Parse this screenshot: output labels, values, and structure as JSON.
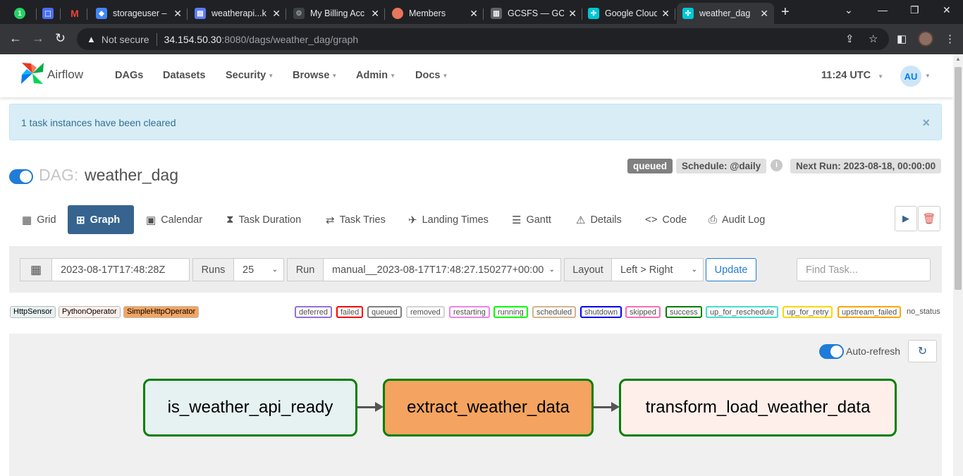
{
  "browser": {
    "tabs": [
      {
        "title": "",
        "favicon": "whatsapp-icon",
        "color": "#25d366"
      },
      {
        "title": "",
        "favicon": "chip-icon",
        "color": "#4c6ef5"
      },
      {
        "title": "",
        "favicon": "gmail-icon",
        "color": "#ea4335"
      },
      {
        "title": "storageuser –",
        "favicon": "shield-icon",
        "color": "#4285f4"
      },
      {
        "title": "weatherapi...k",
        "favicon": "dashboard-icon",
        "color": "#5c7cfa"
      },
      {
        "title": "My Billing Acc",
        "favicon": "gear-icon",
        "color": "#9aa0a6"
      },
      {
        "title": "Members",
        "favicon": "brain-icon",
        "color": "#e8765a"
      },
      {
        "title": "GCSFS — GCS",
        "favicon": "doc-icon",
        "color": "#9aa0a6"
      },
      {
        "title": "Google Cloud",
        "favicon": "airflow-icon",
        "color": "#00c7d4"
      },
      {
        "title": "weather_dag",
        "favicon": "airflow-icon",
        "color": "#00c7d4"
      }
    ],
    "url_warning": "Not secure",
    "url_host": "34.154.50.30",
    "url_path": ":8080/dags/weather_dag/graph"
  },
  "navbar": {
    "brand": "Airflow",
    "menu": [
      "DAGs",
      "Datasets",
      "Security",
      "Browse",
      "Admin",
      "Docs"
    ],
    "time": "11:24 UTC",
    "avatar_initials": "AU"
  },
  "alert": {
    "message": "1 task instances have been cleared",
    "close": "×"
  },
  "dag": {
    "label": "DAG:",
    "id": "weather_dag",
    "state_badge": "queued",
    "schedule": "Schedule: @daily",
    "info": "i",
    "next_run": "Next Run: 2023-08-18, 00:00:00"
  },
  "view_tabs": [
    {
      "label": "Grid",
      "icon": "grid-icon"
    },
    {
      "label": "Graph",
      "icon": "graph-icon"
    },
    {
      "label": "Calendar",
      "icon": "calendar-icon"
    },
    {
      "label": "Task Duration",
      "icon": "hourglass-icon"
    },
    {
      "label": "Task Tries",
      "icon": "retry-icon"
    },
    {
      "label": "Landing Times",
      "icon": "plane-icon"
    },
    {
      "label": "Gantt",
      "icon": "gantt-icon"
    },
    {
      "label": "Details",
      "icon": "warning-icon"
    },
    {
      "label": "Code",
      "icon": "code-icon"
    },
    {
      "label": "Audit Log",
      "icon": "search-file-icon"
    }
  ],
  "filters": {
    "base_date": "2023-08-17T17:48:28Z",
    "runs_label": "Runs",
    "runs_value": "25",
    "run_label": "Run",
    "run_value": "manual__2023-08-17T17:48:27.150277+00:00",
    "layout_label": "Layout",
    "layout_value": "Left > Right",
    "update_label": "Update",
    "find_placeholder": "Find Task..."
  },
  "operators": [
    {
      "name": "HttpSensor",
      "bg": "#e6f1f2"
    },
    {
      "name": "PythonOperator",
      "bg": "#ffefeb"
    },
    {
      "name": "SimpleHttpOperator",
      "bg": "#f4a460"
    }
  ],
  "states": [
    {
      "name": "deferred",
      "color": "#9370db"
    },
    {
      "name": "failed",
      "color": "#ff0000"
    },
    {
      "name": "queued",
      "color": "#808080"
    },
    {
      "name": "removed",
      "color": "#d3d3d3"
    },
    {
      "name": "restarting",
      "color": "#ee82ee"
    },
    {
      "name": "running",
      "color": "#00ff00"
    },
    {
      "name": "scheduled",
      "color": "#d2b48c"
    },
    {
      "name": "shutdown",
      "color": "#0000ff"
    },
    {
      "name": "skipped",
      "color": "#ff69b4"
    },
    {
      "name": "success",
      "color": "#008000"
    },
    {
      "name": "up_for_reschedule",
      "color": "#40e0d0"
    },
    {
      "name": "up_for_retry",
      "color": "#ffd700"
    },
    {
      "name": "upstream_failed",
      "color": "#ffa500"
    },
    {
      "name": "no_status",
      "color": ""
    }
  ],
  "graph": {
    "auto_refresh_label": "Auto-refresh",
    "tasks": [
      {
        "id": "is_weather_api_ready",
        "bg": "#e6f1f2",
        "state_color": "#008000"
      },
      {
        "id": "extract_weather_data",
        "bg": "#f4a460",
        "state_color": "#008000"
      },
      {
        "id": "transform_load_weather_data",
        "bg": "#ffefeb",
        "state_color": "#008000"
      }
    ]
  }
}
